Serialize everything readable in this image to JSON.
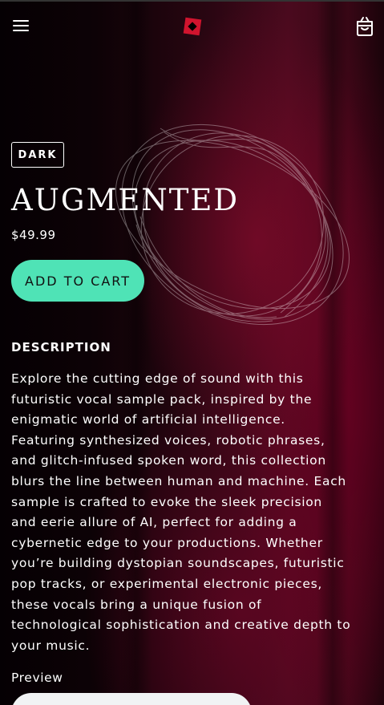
{
  "header": {
    "menu_icon": "hamburger-menu-icon",
    "logo_icon": "brand-logo-icon",
    "cart_icon": "shopping-bag-icon"
  },
  "product": {
    "badge": "DARK",
    "title": "AUGMENTED",
    "price": "$49.99",
    "add_to_cart_label": "ADD TO CART"
  },
  "description": {
    "heading": "DESCRIPTION",
    "lines": [
      "Explore the cutting edge of sound with this",
      "futuristic vocal sample pack, inspired by the",
      "enigmatic world of artificial intelligence.",
      "Featuring synthesized voices, robotic phrases,",
      "and glitch-infused spoken word, this collection",
      "blurs the line between human and machine. Each",
      "sample is crafted to evoke the sleek precision",
      "and eerie allure of AI, perfect for adding a",
      "cybernetic edge to your productions. Whether",
      "you’re building dystopian soundscapes, futuristic",
      "pop tracks, or experimental electronic pieces,",
      "these vocals bring a unique fusion of",
      "technological sophistication and creative depth to",
      "your music."
    ]
  },
  "preview": {
    "label": "Preview"
  },
  "colors": {
    "accent": "#4fe3b6",
    "logo": "#d0142e",
    "background": "#000000"
  }
}
